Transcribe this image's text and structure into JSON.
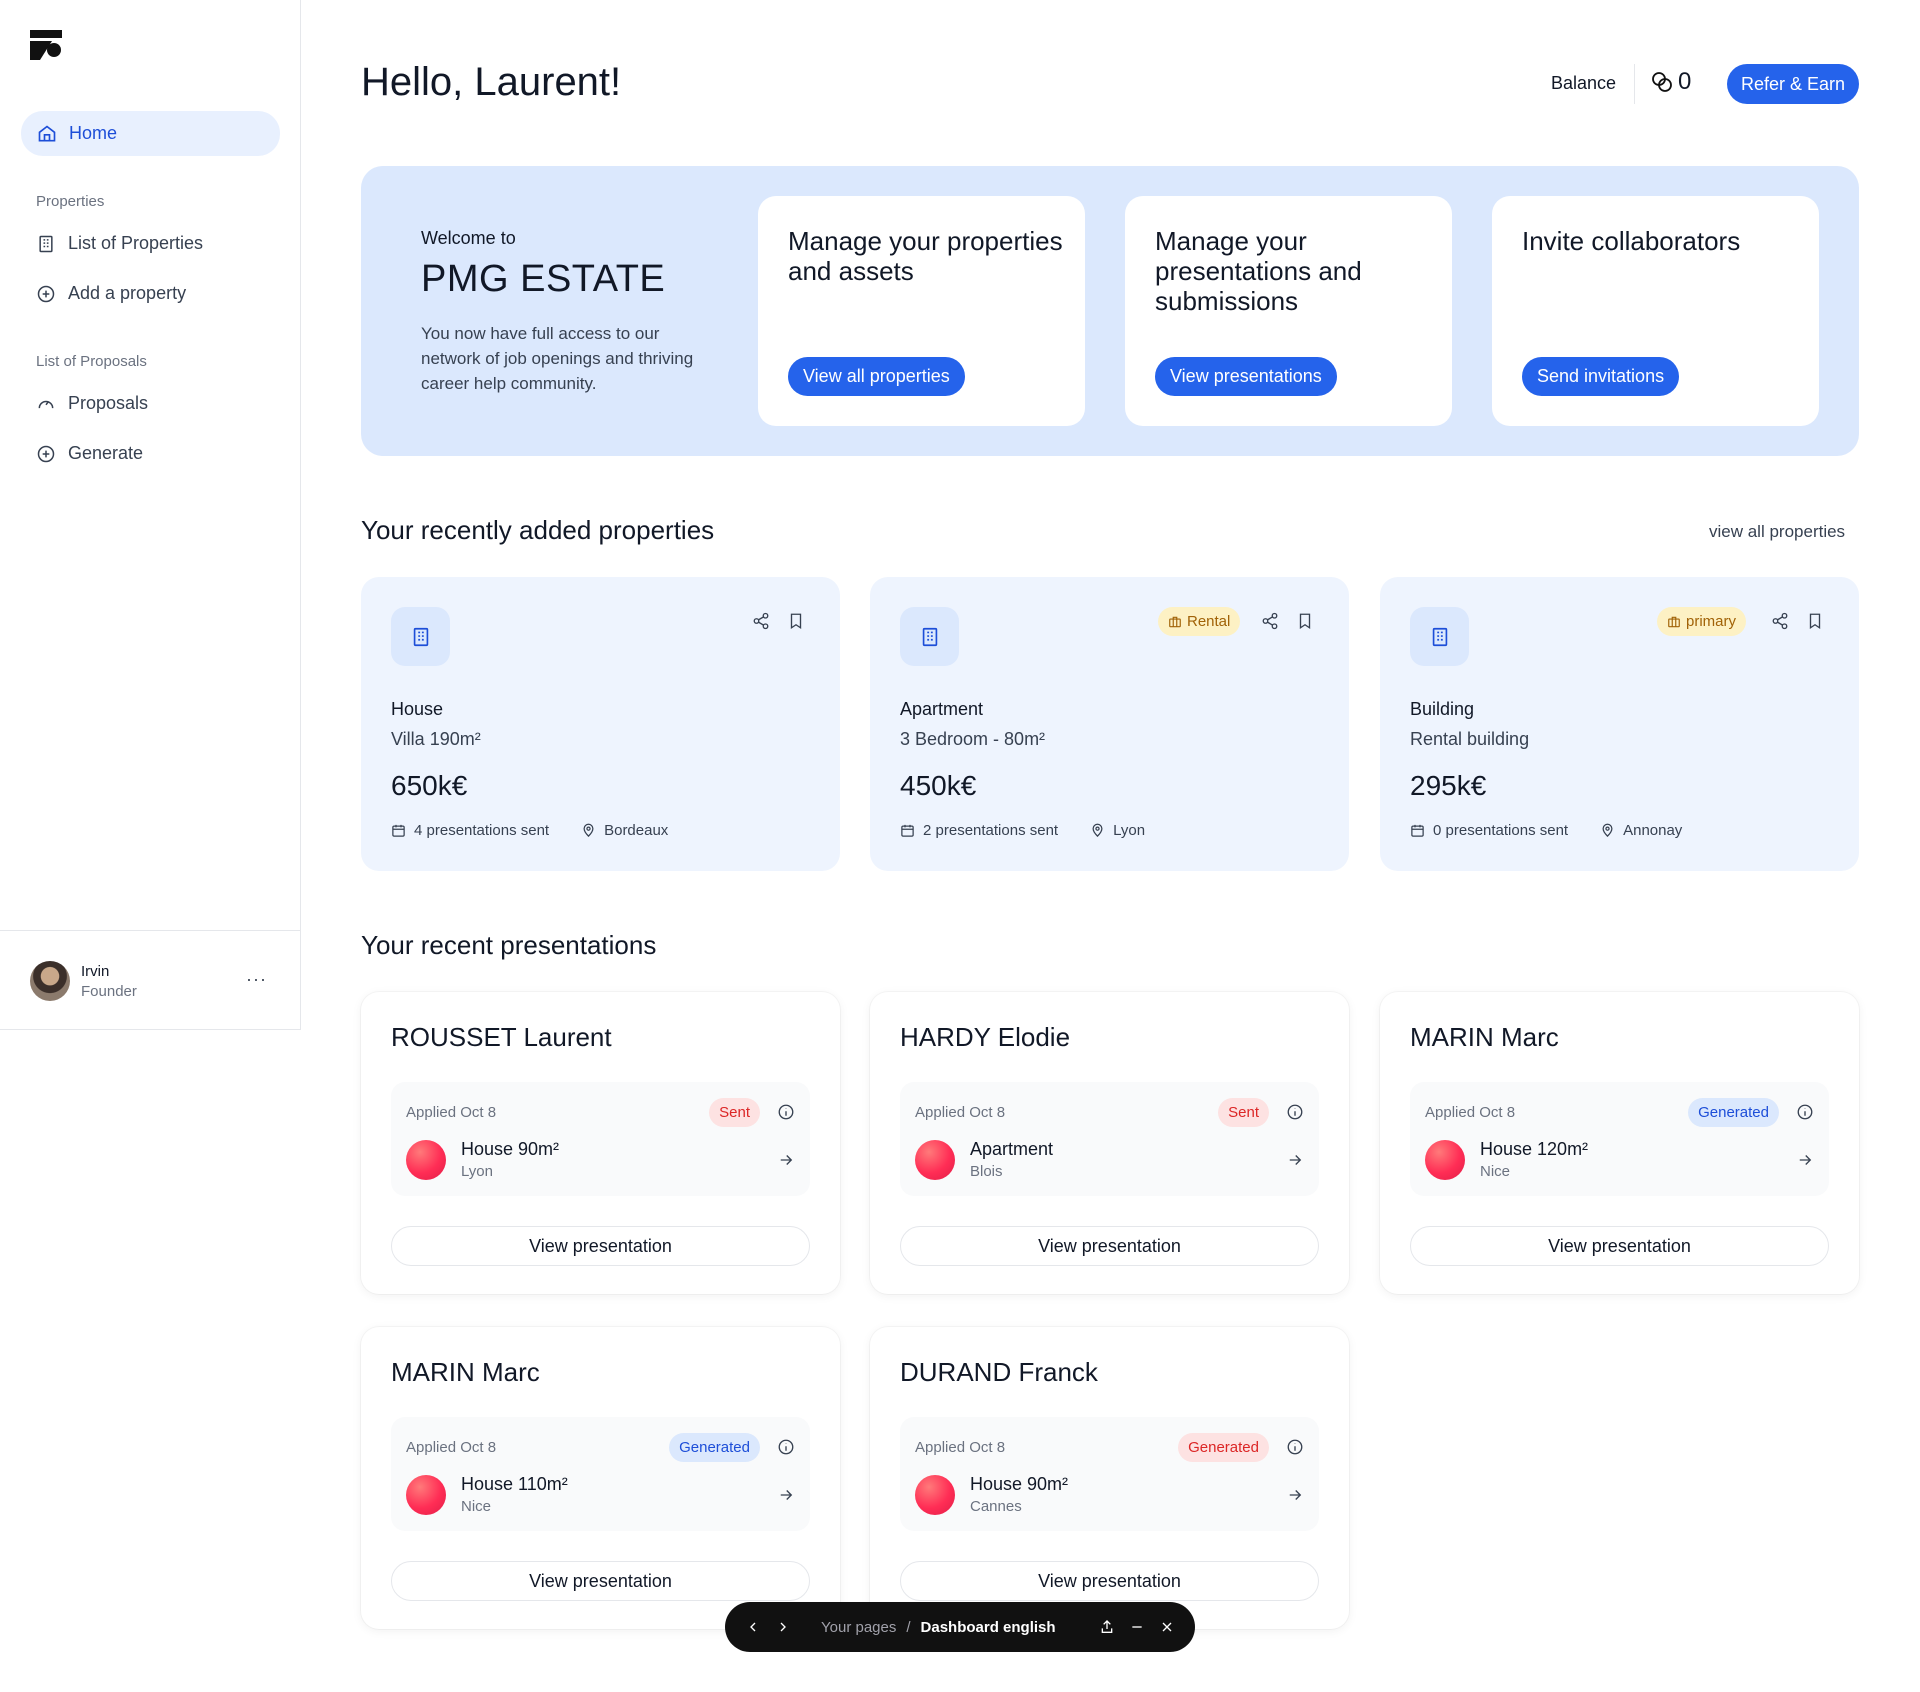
{
  "sidebar": {
    "home_label": "Home",
    "properties_section": "Properties",
    "list_properties": "List of Properties",
    "add_property": "Add a property",
    "proposals_section": "List of Proposals",
    "proposals": "Proposals",
    "generate": "Generate",
    "user": {
      "name": "Irvin",
      "role": "Founder",
      "more": "···"
    }
  },
  "header": {
    "greeting": "Hello, Laurent!",
    "balance_label": "Balance",
    "balance_value": "0",
    "refer_label": "Refer & Earn"
  },
  "banner": {
    "welcome_small": "Welcome to",
    "welcome_big": "PMG ESTATE",
    "description": "You now have full access to our network of job openings and thriving career help community.",
    "cards": [
      {
        "title": "Manage your properties and assets",
        "button": "View all properties"
      },
      {
        "title": "Manage your presentations and submissions",
        "button": "View presentations"
      },
      {
        "title": "Invite collaborators",
        "button": "Send invitations"
      }
    ]
  },
  "properties_section": {
    "title": "Your recently added properties",
    "view_all": "view all properties",
    "items": [
      {
        "type": "House",
        "subtitle": "Villa 190m²",
        "price": "650k€",
        "tag": "",
        "presentations": "4 presentations sent",
        "location": "Bordeaux"
      },
      {
        "type": "Apartment",
        "subtitle": "3 Bedroom - 80m²",
        "price": "450k€",
        "tag": "Rental",
        "presentations": "2 presentations sent",
        "location": "Lyon"
      },
      {
        "type": "Building",
        "subtitle": "Rental building",
        "price": "295k€",
        "tag": "primary",
        "presentations": "0 presentations sent",
        "location": "Annonay"
      }
    ]
  },
  "presentations_section": {
    "title": "Your recent presentations",
    "button_label": "View presentation",
    "items": [
      {
        "name": "ROUSSET Laurent",
        "applied": "Applied Oct 8",
        "status": "Sent",
        "status_color": "#dc2626",
        "property": "House 90m²",
        "city": "Lyon"
      },
      {
        "name": "HARDY Elodie",
        "applied": "Applied Oct 8",
        "status": "Sent",
        "status_color": "#dc2626",
        "property": "Apartment",
        "city": "Blois"
      },
      {
        "name": "MARIN Marc",
        "applied": "Applied Oct 8",
        "status": "Generated",
        "status_color": "#1d4ed8",
        "property": "House 120m²",
        "city": "Nice"
      },
      {
        "name": "MARIN Marc",
        "applied": "Applied Oct 8",
        "status": "Generated",
        "status_color": "#1d4ed8",
        "property": "House 110m²",
        "city": "Nice"
      },
      {
        "name": "DURAND Franck",
        "applied": "Applied Oct 8",
        "status": "Generated",
        "status_color": "#dc2626",
        "property": "House 90m²",
        "city": "Cannes"
      }
    ]
  },
  "floatbar": {
    "crumb_parent": "Your pages",
    "crumb_sep": "/",
    "crumb_current": "Dashboard english"
  },
  "colors": {
    "accent": "#2563eb",
    "banner_bg": "#dbe8fd",
    "card_bg": "#eef4fe"
  }
}
